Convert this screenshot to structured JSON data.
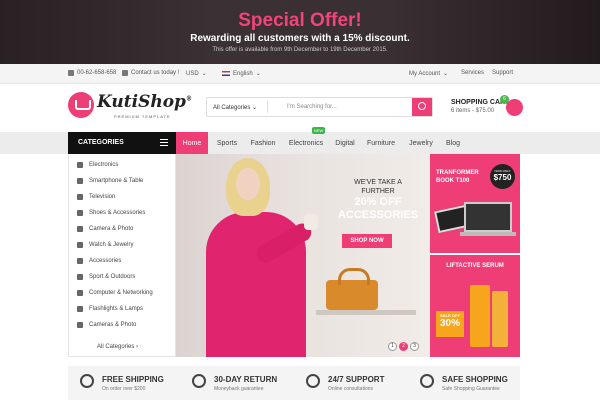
{
  "promo": {
    "title": "Special Offer!",
    "subtitle": "Rewarding all customers with a 15% discount.",
    "note": "This offer is available from 9th December to 19th December 2015."
  },
  "topbar": {
    "phone": "00-62-658-658",
    "contact": "Contact us today !",
    "currency": "USD",
    "language": "English",
    "my_account": "My Account",
    "services": "Services",
    "support": "Support"
  },
  "header": {
    "logo_text": "KutiShop",
    "logo_reg": "®",
    "logo_sub": "PREMIUM TEMPLATE",
    "search_category": "All Categories",
    "search_placeholder": "I'm Searching for...",
    "cart_title": "SHOPPING CART",
    "cart_summary": "6 items - $75.00",
    "cart_count": "6"
  },
  "nav": {
    "categories_label": "CATEGORIES",
    "items": [
      "Home",
      "Sports",
      "Fashion",
      "Electronics",
      "Digital",
      "Furniture",
      "Jewelry",
      "Blog"
    ],
    "new_badge": "NEW"
  },
  "sidebar": {
    "items": [
      "Electronics",
      "Smartphone & Table",
      "Television",
      "Shoes & Accessories",
      "Camera & Photo",
      "Watch & Jewelry",
      "Accessories",
      "Sport & Outdoors",
      "Computer & Networking",
      "Flashlights & Lamps",
      "Cameras & Photo"
    ],
    "all_categories": "All Categories"
  },
  "banner": {
    "line1": "WE'VE TAKE A",
    "line2": "FURTHER",
    "line3": "20% OFF",
    "line4": "ACCESSORIES",
    "button": "SHOP NOW",
    "dots": [
      "1",
      "2",
      "3"
    ],
    "active_dot": 1
  },
  "ads": {
    "ad1_line1": "TRANFORMER",
    "ad1_line2": "BOOK T100",
    "ad1_price_label": "NOW ONLY",
    "ad1_price": "$750",
    "ad2_title": "LIFTACTIVE SERUM",
    "ad2_sale_label": "SALE OFF",
    "ad2_sale_value": "30%"
  },
  "features": [
    {
      "title": "FREE SHIPPING",
      "sub": "On order over $200",
      "icon": "airplane-icon"
    },
    {
      "title": "30-DAY RETURN",
      "sub": "Moneyback guarantee",
      "icon": "return-icon"
    },
    {
      "title": "24/7 SUPPORT",
      "sub": "Online consultations",
      "icon": "support-icon"
    },
    {
      "title": "SAFE SHOPPING",
      "sub": "Safe Shopping Guarantee",
      "icon": "umbrella-icon"
    }
  ],
  "colors": {
    "accent": "#ee3e75",
    "dark": "#111111",
    "badge_green": "#3bb54a"
  }
}
